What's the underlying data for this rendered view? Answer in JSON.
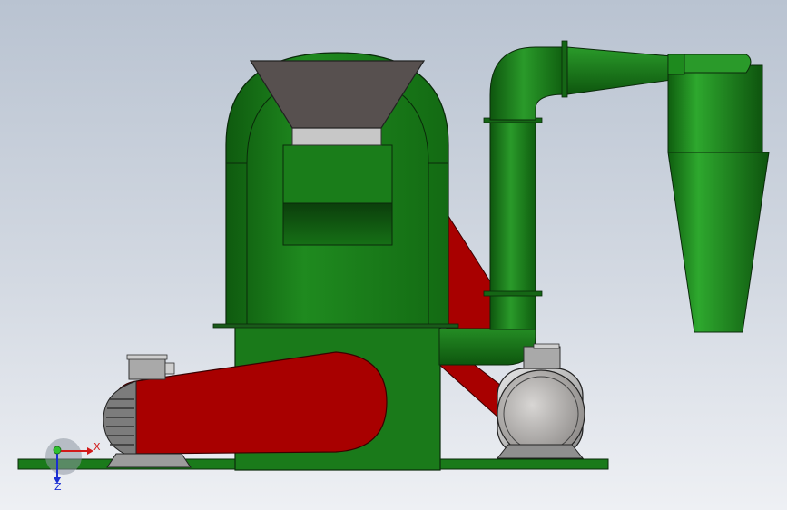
{
  "view": {
    "background_top": "#b9c3d1",
    "background_bottom": "#eef0f4"
  },
  "machine": {
    "body_color": "#1d7a1d",
    "body_dark": "#0c4a0c",
    "belt_guard_color": "#a80000",
    "hopper_color": "#57504f",
    "metal_color": "#c9c9c9",
    "outline_color": "#0a2a0a"
  },
  "triad": {
    "x_label": "X",
    "z_label": "Z",
    "x_color": "#d21a1a",
    "y_color": "#2fbf2f",
    "z_color": "#1a2fd2"
  }
}
